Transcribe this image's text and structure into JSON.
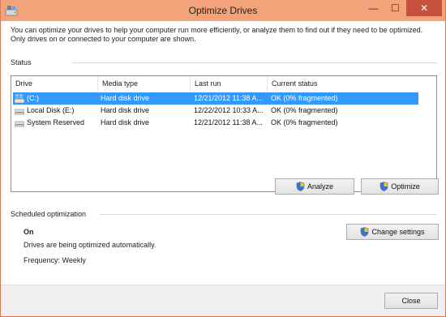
{
  "window": {
    "title": "Optimize Drives",
    "controls": {
      "minimize": "—",
      "maximize": "☐",
      "close": "✕"
    }
  },
  "intro_text": "You can optimize your drives to help your computer run more efficiently, or analyze them to find out if they need to be optimized. Only drives on or connected to your computer are shown.",
  "status": {
    "label": "Status",
    "columns": [
      "Drive",
      "Media type",
      "Last run",
      "Current status"
    ],
    "rows": [
      {
        "drive": "(C:)",
        "media_type": "Hard disk drive",
        "last_run": "12/21/2012 11:38 A...",
        "status": "OK (0% fragmented)",
        "selected": true,
        "icon": "windows-drive-icon"
      },
      {
        "drive": "Local Disk (E:)",
        "media_type": "Hard disk drive",
        "last_run": "12/22/2012 10:33 A...",
        "status": "OK (0% fragmented)",
        "selected": false,
        "icon": "hard-drive-icon"
      },
      {
        "drive": "System Reserved",
        "media_type": "Hard disk drive",
        "last_run": "12/21/2012 11:38 A...",
        "status": "OK (0% fragmented)",
        "selected": false,
        "icon": "hard-drive-icon"
      }
    ]
  },
  "buttons": {
    "analyze": "Analyze",
    "optimize": "Optimize",
    "change_settings": "Change settings",
    "close": "Close"
  },
  "scheduled": {
    "label": "Scheduled optimization",
    "state": "On",
    "description": "Drives are being optimized automatically.",
    "frequency": "Frequency: Weekly"
  },
  "colors": {
    "title_bar": "#f3a37a",
    "close_button": "#c7503f",
    "selection": "#3399ff"
  }
}
